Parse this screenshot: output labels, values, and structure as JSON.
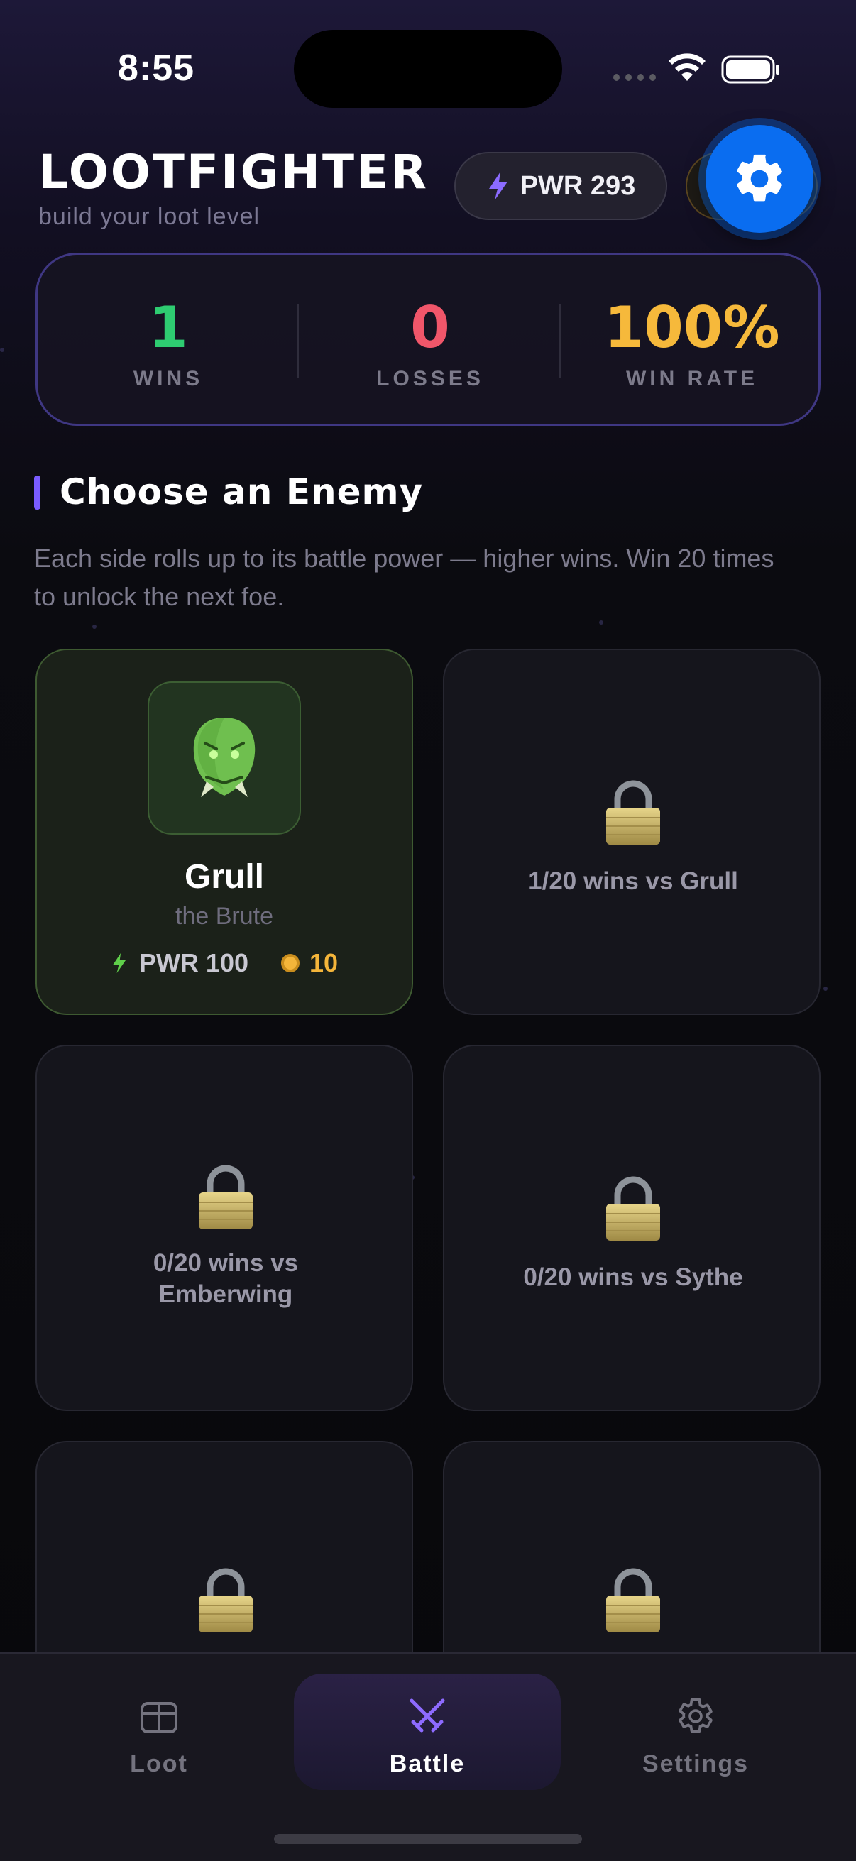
{
  "status_bar": {
    "time": "8:55"
  },
  "header": {
    "title": "LOOTFIGHTER",
    "subtitle": "build your loot level",
    "power_pill": "PWR 293"
  },
  "stats": {
    "wins": {
      "value": "1",
      "label": "WINS",
      "color": "#2ecc71"
    },
    "losses": {
      "value": "0",
      "label": "LOSSES",
      "color": "#f0566a"
    },
    "win_rate": {
      "value": "100%",
      "label": "WIN RATE",
      "color": "#f6b93b"
    }
  },
  "section": {
    "title": "Choose an Enemy",
    "description": "Each side rolls up to its battle power — higher wins. Win 20 times to unlock the next foe."
  },
  "enemies": [
    {
      "name": "Grull",
      "title": "the Brute",
      "power": "PWR 100",
      "reward": "10",
      "icon": "goblin-icon"
    },
    {
      "locked_text": "1/20 wins vs Grull"
    },
    {
      "locked_text": "0/20 wins vs Emberwing"
    },
    {
      "locked_text": "0/20 wins vs Sythe"
    },
    {
      "locked_text": ""
    },
    {
      "locked_text": ""
    }
  ],
  "tabs": [
    {
      "label": "Loot",
      "icon": "cube-icon"
    },
    {
      "label": "Battle",
      "icon": "crossed-swords-icon",
      "active": true
    },
    {
      "label": "Settings",
      "icon": "gear-icon"
    }
  ],
  "colors": {
    "accent": "#7a5cff",
    "fab": "#0a6df0",
    "active_card_border": "#3e5a31"
  }
}
